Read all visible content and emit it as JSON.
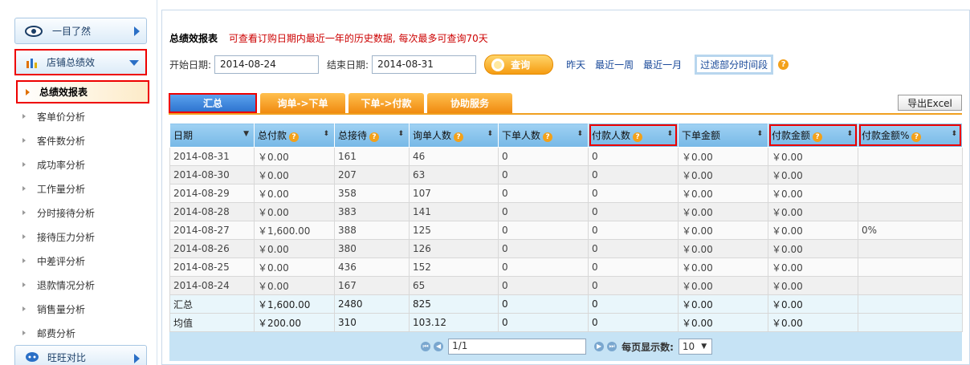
{
  "sidebar": {
    "top_label": "一目了然",
    "section_label": "店铺总绩效",
    "active_item": "总绩效报表",
    "items": [
      "客单价分析",
      "客件数分析",
      "成功率分析",
      "工作量分析",
      "分时接待分析",
      "接待压力分析",
      "中差评分析",
      "退款情况分析",
      "销售量分析",
      "邮费分析"
    ],
    "bottom_label": "旺旺对比"
  },
  "header": {
    "title": "总绩效报表",
    "note": "可查看订购日期内最近一年的历史数据, 每次最多可查询70天"
  },
  "dates": {
    "start_label": "开始日期:",
    "start_value": "2014-08-24",
    "end_label": "结束日期:",
    "end_value": "2014-08-31",
    "query_label": "查询",
    "yesterday": "昨天",
    "last_week": "最近一周",
    "last_month": "最近一月",
    "filter": "过滤部分时间段"
  },
  "tabs": [
    "汇总",
    "询单->下单",
    "下单->付款",
    "协助服务"
  ],
  "export_label": "导出Excel",
  "table": {
    "headers": [
      "日期",
      "总付款",
      "总接待",
      "询单人数",
      "下单人数",
      "付款人数",
      "下单金额",
      "付款金额",
      "付款金额%"
    ],
    "rows": [
      [
        "2014-08-31",
        "￥0.00",
        "161",
        "46",
        "0",
        "0",
        "￥0.00",
        "￥0.00",
        ""
      ],
      [
        "2014-08-30",
        "￥0.00",
        "207",
        "63",
        "0",
        "0",
        "￥0.00",
        "￥0.00",
        ""
      ],
      [
        "2014-08-29",
        "￥0.00",
        "358",
        "107",
        "0",
        "0",
        "￥0.00",
        "￥0.00",
        ""
      ],
      [
        "2014-08-28",
        "￥0.00",
        "383",
        "141",
        "0",
        "0",
        "￥0.00",
        "￥0.00",
        ""
      ],
      [
        "2014-08-27",
        "￥1,600.00",
        "388",
        "125",
        "0",
        "0",
        "￥0.00",
        "￥0.00",
        "0%"
      ],
      [
        "2014-08-26",
        "￥0.00",
        "380",
        "126",
        "0",
        "0",
        "￥0.00",
        "￥0.00",
        ""
      ],
      [
        "2014-08-25",
        "￥0.00",
        "436",
        "152",
        "0",
        "0",
        "￥0.00",
        "￥0.00",
        ""
      ],
      [
        "2014-08-24",
        "￥0.00",
        "167",
        "65",
        "0",
        "0",
        "￥0.00",
        "￥0.00",
        ""
      ]
    ],
    "summary": [
      [
        "汇总",
        "￥1,600.00",
        "2480",
        "825",
        "0",
        "0",
        "￥0.00",
        "￥0.00",
        ""
      ],
      [
        "均值",
        "￥200.00",
        "310",
        "103.12",
        "0",
        "0",
        "￥0.00",
        "￥0.00",
        ""
      ]
    ]
  },
  "pager": {
    "page": "1/1",
    "per_page_label": "每页显示数:",
    "per_page": "10"
  }
}
